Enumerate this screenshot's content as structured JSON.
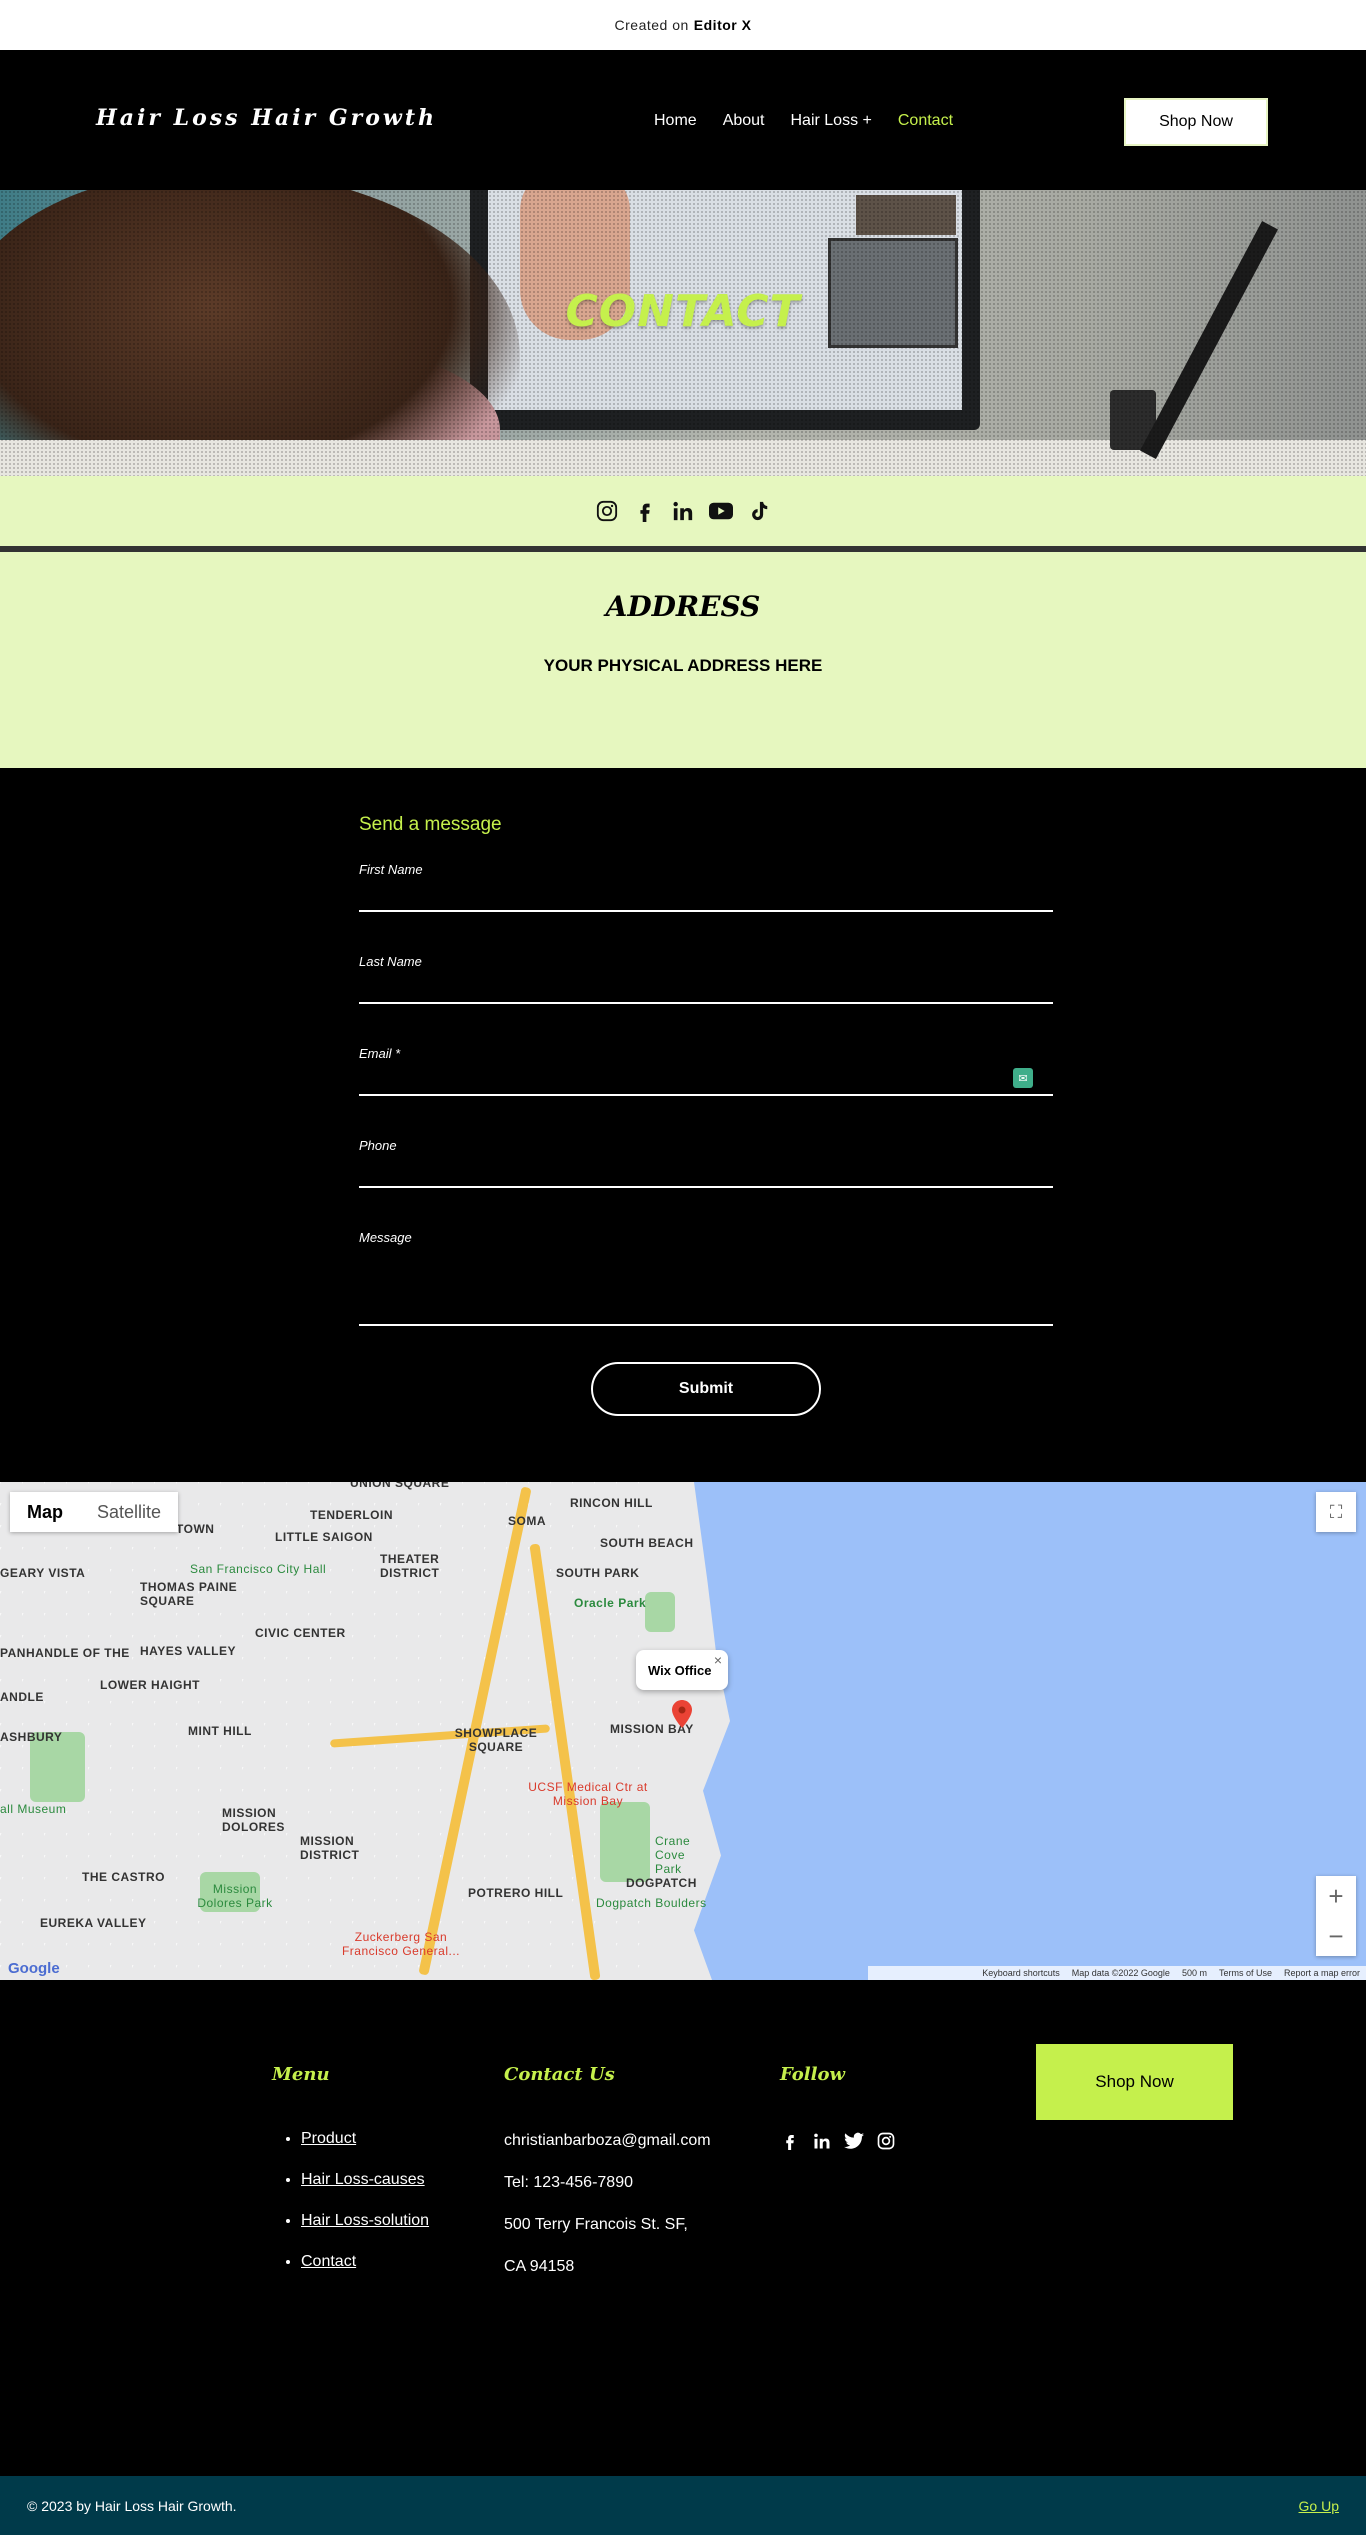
{
  "topbar": {
    "created_on": "Created on",
    "brand": "Editor X"
  },
  "header": {
    "logo": "Hair Loss Hair Growth",
    "nav": [
      "Home",
      "About",
      "Hair Loss +",
      "Contact"
    ],
    "active_nav": "Contact",
    "shop_button": "Shop Now"
  },
  "hero": {
    "title": "CONTACT"
  },
  "social": {
    "icons": [
      "instagram-icon",
      "facebook-icon",
      "linkedin-icon",
      "youtube-icon",
      "tiktok-icon"
    ]
  },
  "address": {
    "title": "ADDRESS",
    "text": "YOUR PHYSICAL ADDRESS HERE"
  },
  "form": {
    "title": "Send a message",
    "fields": [
      {
        "label": "First Name",
        "value": ""
      },
      {
        "label": "Last Name",
        "value": ""
      },
      {
        "label": "Email *",
        "value": ""
      },
      {
        "label": "Phone",
        "value": ""
      },
      {
        "label": "Message",
        "value": ""
      }
    ],
    "submit": "Submit"
  },
  "map": {
    "type_options": [
      "Map",
      "Satellite"
    ],
    "selected_type": "Map",
    "marker_label": "Wix Office",
    "labels": [
      "UNION SQUARE",
      "TENDERLOIN",
      "LITTLE SAIGON",
      "SOMA",
      "RINCON HILL",
      "SOUTH BEACH",
      "San Francisco City Hall",
      "THEATER DISTRICT",
      "SOUTH PARK",
      "THOMAS PAINE SQUARE",
      "CIVIC CENTER",
      "Oracle Park",
      "HAYES VALLEY",
      "LOWER HAIGHT",
      "MINT HILL",
      "SHOWPLACE SQUARE",
      "MISSION BAY",
      "MISSION DOLORES",
      "MISSION DISTRICT",
      "UCSF Medical Ctr at Mission Bay",
      "Crane Cove Park",
      "THE CASTRO",
      "Mission Dolores Park",
      "POTRERO HILL",
      "DOGPATCH",
      "Dogpatch Boulders",
      "EUREKA VALLEY",
      "Zuckerberg San Francisco General...",
      "TOWN",
      "GEARY VISTA",
      "PANHANDLE OF THE",
      "ANDLE",
      "ASHBURY",
      "all Museum"
    ],
    "footer": [
      "Keyboard shortcuts",
      "Map data ©2022 Google",
      "500 m",
      "Terms of Use",
      "Report a map error"
    ],
    "google_logo": "Google"
  },
  "footer": {
    "menu_title": "Menu",
    "menu_items": [
      "Product",
      "Hair Loss-causes",
      "Hair Loss-solution",
      "Contact"
    ],
    "contact_title": "Contact Us",
    "contact_lines": [
      "christianbarboza@gmail.com",
      "Tel: 123-456-7890",
      "500 Terry Francois St. SF,",
      "CA 94158"
    ],
    "follow_title": "Follow",
    "follow_icons": [
      "facebook-icon",
      "linkedin-icon",
      "twitter-icon",
      "instagram-icon"
    ],
    "shop_button": "Shop Now"
  },
  "bottombar": {
    "copyright": "© 2023 by Hair Loss Hair Growth.",
    "go_up": "Go Up"
  },
  "colors": {
    "accent": "#c5f04c",
    "light_green": "#e6f7bf",
    "bottom_bar": "#003a4a"
  }
}
